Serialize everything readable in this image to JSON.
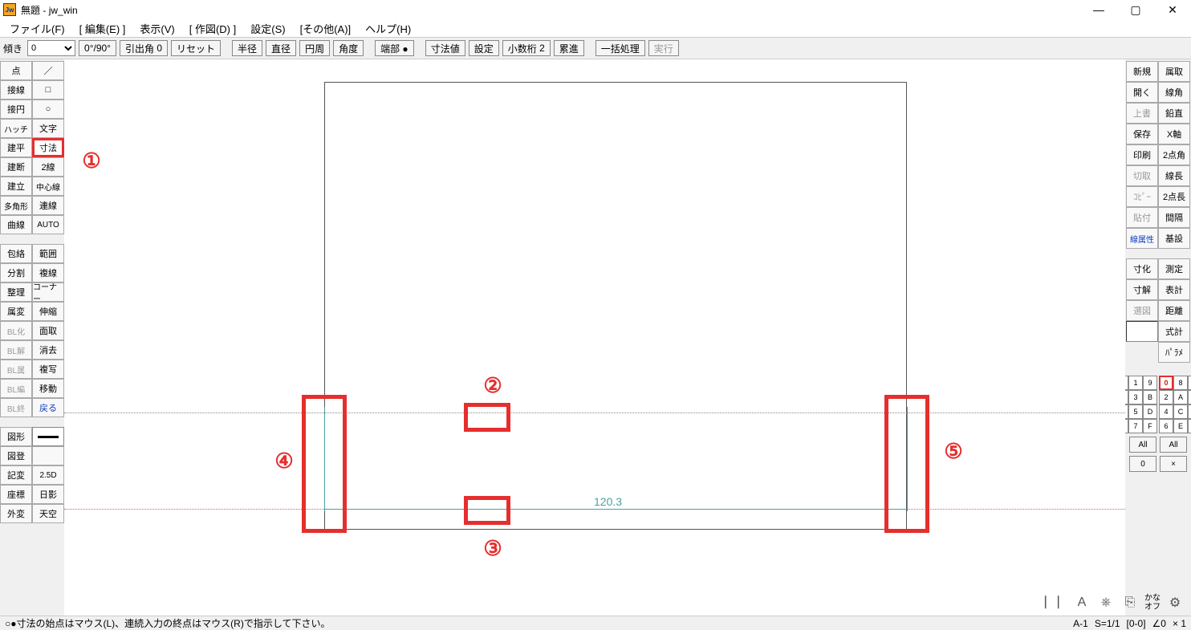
{
  "window": {
    "title_prefix": "無題",
    "title_app": "jw_win",
    "icon_text": "Jw"
  },
  "menu": [
    "ファイル(F)",
    "[ 編集(E) ]",
    "表示(V)",
    "[ 作図(D) ]",
    "設定(S)",
    "[その他(A)]",
    "ヘルプ(H)"
  ],
  "toolbar": {
    "slope_label": "傾き",
    "slope_value": "0",
    "angle_btn": "0°/90°",
    "leader_label": "引出角",
    "leader_value": "0",
    "reset": "リセット",
    "hanR": "半径",
    "chok": "直径",
    "ensh": "円周",
    "kakudo": "角度",
    "tanbu": "端部 ●",
    "sunpo": "寸法値",
    "settei": "設定",
    "shosu": "小数桁",
    "shosu_val": "2",
    "ruishin": "累進",
    "ikkatsu": "一括処理",
    "jikko": "実行"
  },
  "left_tools": {
    "col1": [
      "点",
      "接線",
      "接円",
      "ハッチ",
      "建平",
      "建断",
      "建立",
      "多角形",
      "曲線"
    ],
    "col2_icons": [
      "line",
      "rect",
      "circle"
    ],
    "col2_text": [
      "文字",
      "寸法",
      "2線",
      "中心線",
      "連線",
      "AUTO"
    ],
    "col1b": [
      "包絡",
      "分割",
      "整理",
      "属変",
      "BL化",
      "BL解",
      "BL属",
      "BL編",
      "BL終"
    ],
    "col2b": [
      "範囲",
      "複線",
      "コーナー",
      "伸縮",
      "面取",
      "消去",
      "複写",
      "移動",
      "戻る"
    ],
    "col1c": [
      "図形",
      "図登",
      "記変",
      "座標",
      "外変"
    ],
    "col2c": [
      "",
      "",
      "2.5D",
      "日影",
      "天空"
    ]
  },
  "right_tools": {
    "row1": [
      "新規",
      "属取"
    ],
    "row2": [
      "開く",
      "線角"
    ],
    "row3": [
      "上書",
      "鉛直"
    ],
    "row4": [
      "保存",
      "X軸"
    ],
    "row5": [
      "印刷",
      "2点角"
    ],
    "row6": [
      "切取",
      "線長"
    ],
    "row7": [
      "ｺﾋﾟｰ",
      "2点長"
    ],
    "row8": [
      "貼付",
      "間隔"
    ],
    "row9": [
      "線属性",
      "基設"
    ],
    "row10": [
      "寸化",
      "測定"
    ],
    "row11": [
      "寸解",
      "表計"
    ],
    "row12": [
      "選図",
      "距離"
    ],
    "row13": [
      "",
      "式計"
    ],
    "row14": [
      "",
      "ﾊﾟﾗﾒ"
    ]
  },
  "layers": {
    "group_a": [
      "0",
      "8",
      "1",
      "9",
      "2",
      "A",
      "3",
      "B",
      "4",
      "C",
      "5",
      "D",
      "6",
      "E",
      "7",
      "F"
    ],
    "all_btn": "All",
    "zero_btn": "0",
    "x_btn": "×"
  },
  "canvas": {
    "dim_value": "120.3"
  },
  "callouts": {
    "c1": "①",
    "c2": "②",
    "c3": "③",
    "c4": "④",
    "c5": "⑤"
  },
  "status": {
    "msg": "○●寸法の始点はマウス(L)、連続入力の終点はマウス(R)で指示して下さい。",
    "info_a": "A-1",
    "info_s": "S=1/1",
    "info_coord": "[0-0]",
    "info_ang": "∠0",
    "info_x": "× 1"
  },
  "tray": {
    "kana": "かな",
    "off": "オフ"
  }
}
